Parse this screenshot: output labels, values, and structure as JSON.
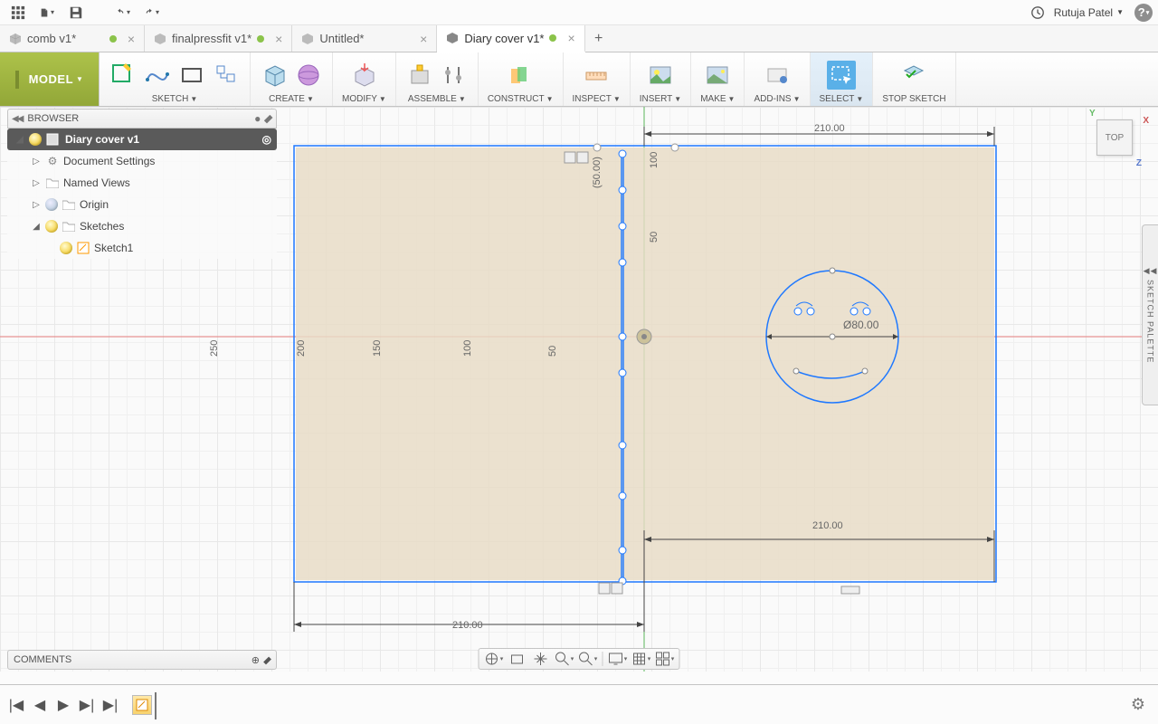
{
  "qat": {
    "user": "Rutuja Patel"
  },
  "tabs": [
    {
      "label": "comb v1*",
      "active": false,
      "dirty": true
    },
    {
      "label": "finalpressfit v1*",
      "active": false,
      "dirty": true
    },
    {
      "label": "Untitled*",
      "active": false,
      "dirty": false
    },
    {
      "label": "Diary cover v1*",
      "active": true,
      "dirty": true
    }
  ],
  "ribbon": {
    "workspace": "MODEL",
    "groups": [
      "SKETCH",
      "CREATE",
      "MODIFY",
      "ASSEMBLE",
      "CONSTRUCT",
      "INSPECT",
      "INSERT",
      "MAKE",
      "ADD-INS",
      "SELECT",
      "STOP SKETCH"
    ]
  },
  "browser": {
    "title": "BROWSER",
    "root": "Diary cover v1",
    "items": [
      "Document Settings",
      "Named Views",
      "Origin",
      "Sketches"
    ],
    "sketch": "Sketch1"
  },
  "dims": {
    "w_top": "210.00",
    "w_bot_right": "210.00",
    "w_bot_left": "210.00",
    "h_left_outer": "250",
    "h_left_inner": "200",
    "g150": "150",
    "g100": "100",
    "g50": "50",
    "top100": "100",
    "top50_paren": "(50.00)",
    "top50": "50",
    "dia": "Ø80.00"
  },
  "viewcube": {
    "face": "TOP",
    "x": "X",
    "y": "Y",
    "z": "Z"
  },
  "palette": "SKETCH PALETTE",
  "comments": "COMMENTS"
}
